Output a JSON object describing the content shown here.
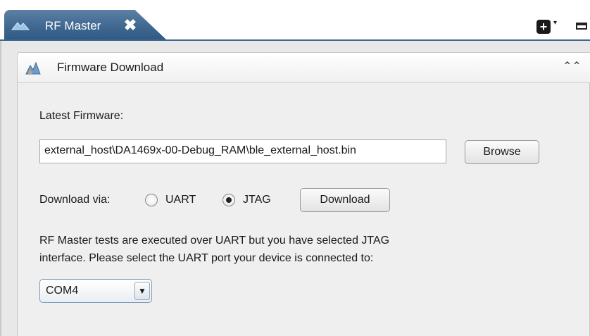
{
  "tab": {
    "title": "RF Master",
    "close_glyph": "✖"
  },
  "toolbar": {
    "new_icon": "plus-box-icon",
    "new_glyph": "+",
    "caret_glyph": "▾",
    "minimize_icon": "minimize-icon"
  },
  "section": {
    "title": "Firmware Download",
    "collapse_glyph": "⌃⌃"
  },
  "firmware": {
    "label": "Latest Firmware:",
    "path_value": "external_host\\DA1469x-00-Debug_RAM\\ble_external_host.bin",
    "browse_label": "Browse"
  },
  "download": {
    "via_label": "Download via:",
    "options": [
      {
        "label": "UART",
        "selected": false
      },
      {
        "label": "JTAG",
        "selected": true
      }
    ],
    "button_label": "Download"
  },
  "notice": {
    "line1": "RF Master tests are executed over UART but you have selected JTAG",
    "line2": "interface. Please select the UART port your device is connected to:"
  },
  "port": {
    "selected": "COM4",
    "arrow_glyph": "▼"
  },
  "colors": {
    "tab": "#3f6891",
    "panel": "#efefef",
    "view": "#e8e8e8"
  }
}
